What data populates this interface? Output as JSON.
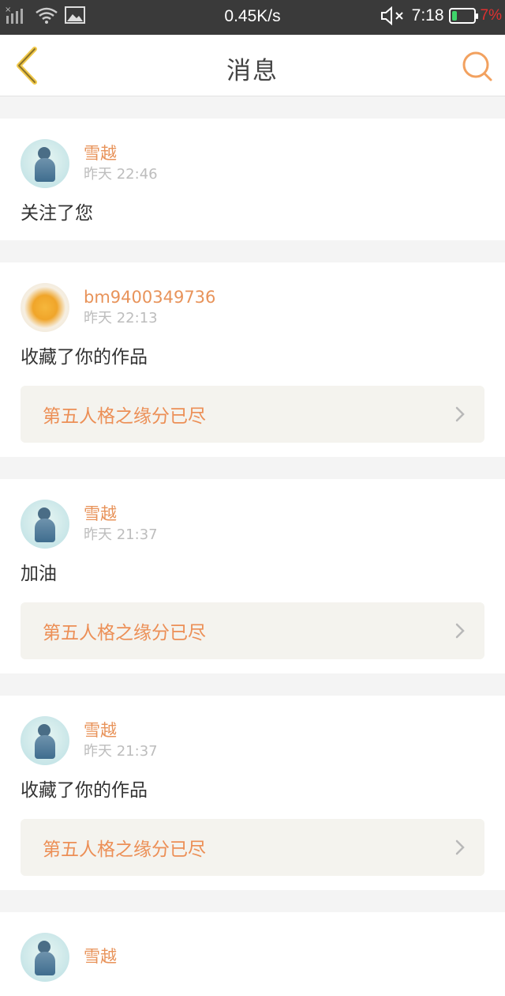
{
  "status_bar": {
    "network_speed": "0.45K/s",
    "time": "7:18",
    "battery": "7%",
    "battery_fill_fraction": 0.07,
    "icons": [
      "signal-icon",
      "wifi-icon",
      "image-notification-icon",
      "mute-icon",
      "battery-icon"
    ]
  },
  "header": {
    "title": "消息",
    "back_icon": "chevron-left-icon",
    "search_icon": "search-icon",
    "accent_color": "#f2a15f"
  },
  "messages": [
    {
      "name": "雪越",
      "time": "昨天 22:46",
      "text": "关注了您",
      "avatar": "girl",
      "work": null
    },
    {
      "name": "bm9400349736",
      "time": "昨天 22:13",
      "text": "收藏了你的作品",
      "avatar": "food",
      "work": "第五人格之缘分已尽"
    },
    {
      "name": "雪越",
      "time": "昨天 21:37",
      "text": "加油",
      "avatar": "girl",
      "work": "第五人格之缘分已尽"
    },
    {
      "name": "雪越",
      "time": "昨天 21:37",
      "text": "收藏了你的作品",
      "avatar": "girl",
      "work": "第五人格之缘分已尽"
    },
    {
      "name": "雪越",
      "time": "",
      "text": "",
      "avatar": "girl",
      "work": null
    }
  ]
}
